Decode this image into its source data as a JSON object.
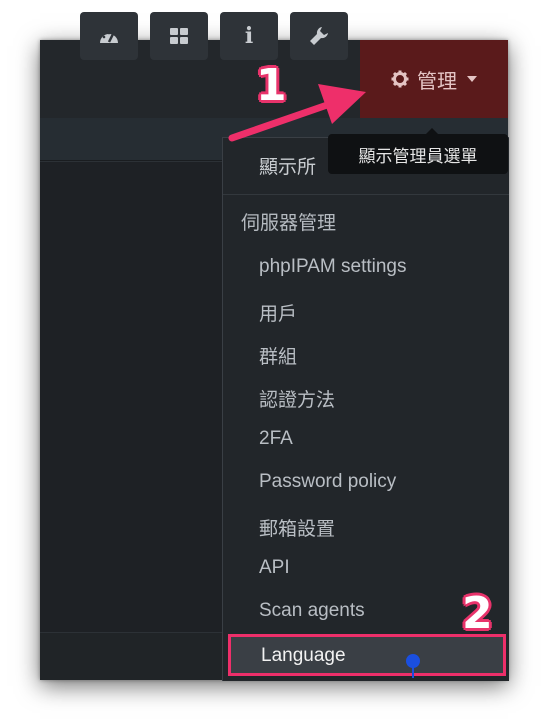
{
  "navbar": {
    "buttons": [
      {
        "icon": "dashboard-icon"
      },
      {
        "icon": "grid-icon"
      },
      {
        "icon": "info-icon",
        "glyph": "i"
      },
      {
        "icon": "wrench-icon"
      }
    ],
    "admin_button": {
      "label": "管理",
      "icon": "gear-icon",
      "color": "#5a1a1b"
    }
  },
  "tooltip": {
    "text": "顯示管理員選單"
  },
  "menu": {
    "top_item": "顯示所",
    "section_header": "伺服器管理",
    "items": [
      "phpIPAM settings",
      "用戶",
      "群組",
      "認證方法",
      "2FA",
      "Password policy",
      "郵箱設置",
      "API",
      "Scan agents"
    ],
    "highlighted_item": "Language"
  },
  "annotations": {
    "step1": "1",
    "step2": "2",
    "accent_color": "#ee2f6a"
  }
}
